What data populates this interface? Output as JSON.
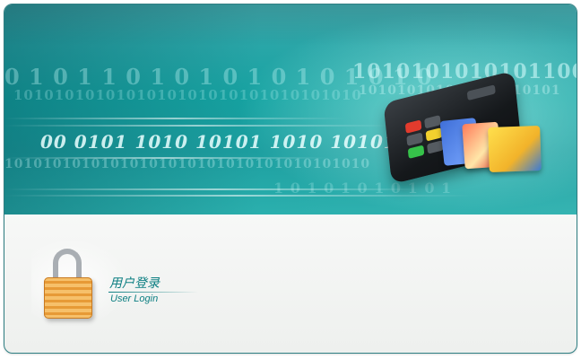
{
  "banner": {
    "binary_rows": [
      "0 1 0 1 1 0 1 0 1 0 1 0 1 0 1 0 1 0",
      "1010101010101010101010101010101010",
      "1010101010101100",
      "101010101010101010101",
      "00 0101  1010  10101 1010  10101",
      "10101010101010101010101010101010101010",
      "1 0 1 0 1 0 1 0 1 0 1"
    ]
  },
  "login": {
    "title": "用户登录",
    "subtitle": "User Login"
  },
  "icons": {
    "lock": "lock-icon",
    "device": "pos-terminal-illustration"
  },
  "colors": {
    "banner": "#1fa4a4",
    "accent": "#0d7f82",
    "lock_gold": "#f0a845",
    "border": "#2f7f83"
  }
}
